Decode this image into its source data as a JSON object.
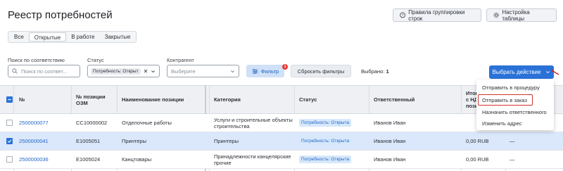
{
  "header": {
    "title": "Реестр потребностей",
    "grouping_button": "Правила группировки строк",
    "settings_button": "Настройка таблицы"
  },
  "tabs": [
    {
      "label": "Все",
      "active": false
    },
    {
      "label": "Открытые",
      "active": true
    },
    {
      "label": "В работе",
      "active": false
    },
    {
      "label": "Закрытые",
      "active": false
    }
  ],
  "filters": {
    "search_label": "Поиск по соответствию",
    "search_placeholder": "Поиск по соответ...",
    "status_label": "Статус",
    "status_value": "Потребность: Открыт",
    "contractor_label": "Контрагент",
    "contractor_placeholder": "Выберите",
    "filter_button": "Фильтр",
    "filter_badge": "1",
    "reset_button": "Сбросить фильтры",
    "selected_label": "Выбрано:",
    "selected_count": "1",
    "action_button": "Выбрать действие"
  },
  "table": {
    "columns": {
      "num": "№",
      "ozm": "№ позиции ОЗМ",
      "name": "Наименование позиции",
      "category": "Категория",
      "status": "Статус",
      "responsible": "Ответственный",
      "total_1": "Итог",
      "total_2": "с НД",
      "total_3": "пози"
    },
    "rows": [
      {
        "num": "2500000077",
        "ozm": "CC10000002",
        "name": "Отделочные работы",
        "category_1": "Услуги и строительные объекты",
        "category_2": "строительства",
        "status": "Потребность: Открыта",
        "responsible": "Иванов Иван",
        "total": "",
        "extra": "",
        "checked": false
      },
      {
        "num": "2500000041",
        "ozm": "E1005051",
        "name": "Принтеры",
        "category_1": "Принтеры",
        "category_2": "",
        "status": "Потребность: Открыта",
        "responsible": "Иванов Иван",
        "total": "0,00 RUB",
        "extra": "—",
        "checked": true
      },
      {
        "num": "2500000036",
        "ozm": "E1005024",
        "name": "Канцтовары",
        "category_1": "Принадлежности канцелярские",
        "category_2": "прочие",
        "status": "Потребность: Открыта",
        "responsible": "Иванов Иван",
        "total": "0,00 RUB",
        "extra": "—",
        "checked": false
      }
    ]
  },
  "action_menu": {
    "items": [
      "Отправить в процедуру",
      "Отправить в заказ",
      "Назначить ответственного",
      "Изменить адрес"
    ],
    "highlighted_index": 1
  },
  "colors": {
    "accent": "#2a72d8",
    "selected_row": "#dbe8fb",
    "status_chip": "#d6e8fb",
    "highlight_border": "#d0342c"
  }
}
